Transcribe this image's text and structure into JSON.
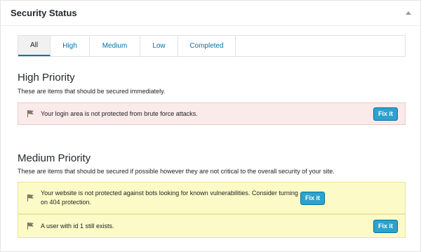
{
  "panel": {
    "title": "Security Status"
  },
  "tabs": [
    {
      "label": "All"
    },
    {
      "label": "High"
    },
    {
      "label": "Medium"
    },
    {
      "label": "Low"
    },
    {
      "label": "Completed"
    }
  ],
  "high": {
    "title": "High Priority",
    "description": "These are items that should be secured immediately.",
    "items": [
      {
        "text": "Your login area is not protected from brute force attacks.",
        "button": "Fix it"
      }
    ]
  },
  "medium": {
    "title": "Medium Priority",
    "description": "These are items that should be secured if possible however they are not critical to the overall security of your site.",
    "items": [
      {
        "text": "Your website is not protected against bots looking for known vulnerabilities. Consider turning on 404 protection.",
        "button": "Fix it"
      },
      {
        "text": "A user with id 1 still exists.",
        "button": "Fix it"
      }
    ]
  },
  "colors": {
    "accent": "#0073aa",
    "button": "#2ea2cc",
    "high_bg": "#fbeaea",
    "medium_bg": "#fcfbc7"
  },
  "icons": {
    "collapse": "triangle-up-icon",
    "issue": "flag-icon"
  }
}
